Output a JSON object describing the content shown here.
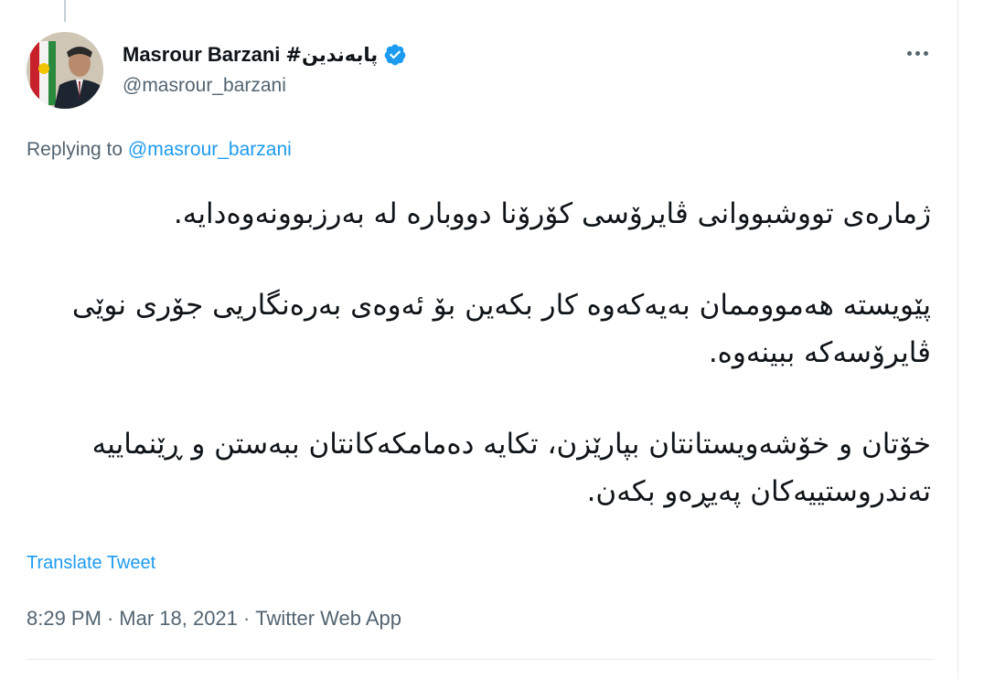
{
  "tweet": {
    "author": {
      "display_name": "Masrour Barzani",
      "display_name_suffix": "#پابەندین",
      "handle": "@masrour_barzani",
      "verified": true,
      "verified_icon": "verified-badge-icon"
    },
    "replying_to": {
      "prefix": "Replying to",
      "mention": "@masrour_barzani"
    },
    "body_paragraphs": [
      "ژمارەی تووشبووانی ڤایرۆسی کۆرۆنا دووبارە لە بەرزبوونەوەدایە.",
      "پێویستە هەمووممان بەیەکەوە کار بکەین بۆ ئەوەی بەرەنگاریی جۆری نوێی ڤایرۆسەکە ببینەوە.",
      "خۆتان و خۆشەویستانتان بپارێزن، تکایە دەمامکەکانتان ببەستن و ڕێنماییە تەندروستییەکان پەیڕەو بکەن."
    ],
    "translate_label": "Translate Tweet",
    "time": "8:29 PM",
    "separator": "·",
    "date": "Mar 18, 2021",
    "source": "Twitter Web App",
    "more_icon": "more-options-icon"
  },
  "colors": {
    "link": "#1d9bf0",
    "secondary_text": "#536471",
    "primary_text": "#0f1419",
    "border": "#e6ecf0"
  }
}
